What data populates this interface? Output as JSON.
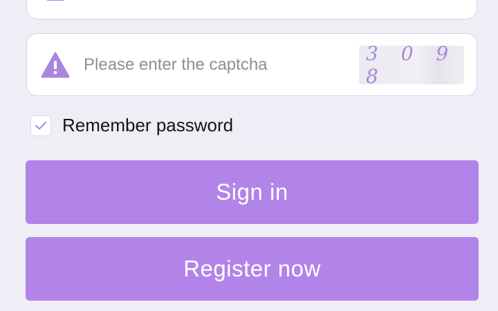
{
  "captcha": {
    "placeholder": "Please enter the captcha",
    "value": "",
    "code": "3 0 9 8",
    "icon": "warning-triangle-icon"
  },
  "remember": {
    "label": "Remember password",
    "checked": true
  },
  "buttons": {
    "sign_in": "Sign in",
    "register": "Register now"
  },
  "colors": {
    "accent": "#b283e8",
    "background": "#efedf5",
    "captcha_text": "#a58ad9"
  }
}
